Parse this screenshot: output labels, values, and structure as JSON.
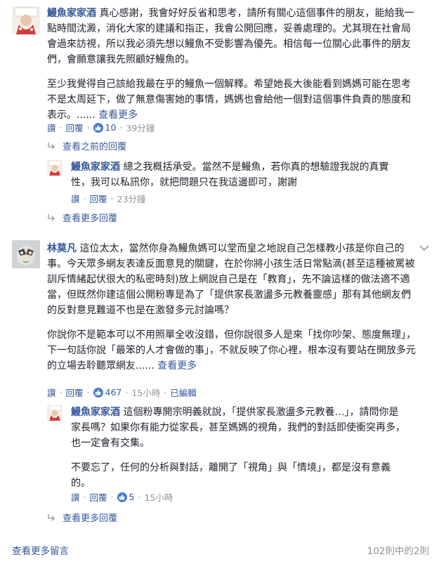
{
  "colors": {
    "link": "#365899",
    "muted": "#90949c",
    "like": "#4a7bd4"
  },
  "comments": [
    {
      "author": "鰻魚家家酒",
      "paragraphs": [
        "真心感謝，我會好好反省和思考，請所有關心這個事件的朋友，能給我一點時間沈澱，消化大家的建議和指正，我會公開回應，妥善處理的。尤其現在社會局會過來訪視，所以我必須先想以鰻魚不受影響為優先。相信每一位關心此事件的朋友們，會願意讓我先照顧好鰻魚的。",
        "至少我覺得自己該給我最在乎的鰻魚一個解釋。希望她長大後能看到媽媽可能在思考不是太周延下，做了無意傷害她的事情，媽媽也會給他一個對這個事件負責的態度和表示。......"
      ],
      "see_more": "查看更多",
      "actions": {
        "like": "讚",
        "reply": "回覆",
        "likes": "10",
        "time": "39分鐘"
      },
      "view_previous": "查看之前的回覆",
      "reply": {
        "author": "鰻魚家家酒",
        "text": "總之我概括承受。當然不是鰻魚，若你真的想驗證我說的真實性，我可以私訊你，就把問題只在我這邊即可，謝謝",
        "actions": {
          "like": "讚",
          "reply": "回覆",
          "time": "23分鐘"
        }
      },
      "view_more_replies": "查看更多回覆"
    },
    {
      "author": "林莫凡",
      "paragraphs": [
        "這位太太，當然你身為鰻魚媽可以堂而皇之地說自己怎樣教小孩是你自己的事。今天眾多網友表達反面意見的關鍵，在於你將小孩生活日常點滴(甚至這種被罵被訓斥情緒起伏很大的私密時刻)放上網說自己是在「教育」，先不論這樣的做法適不適當，但既然你建這個公開粉專是為了「提供家長激盪多元教養靈感」那有其他網友們的反對意見難道不也是在激發多元討論嗎？",
        "你說你不是範本可以不用照單全收沒錯，但你說很多人是來「找你吵架、態度無理」，下一句話你說「最笨的人才會做的事」，不就反映了你心裡，根本沒有要站在開放多元的立場去聆聽眾網友......"
      ],
      "see_more": "查看更多",
      "actions": {
        "like": "讚",
        "reply": "回覆",
        "likes": "467",
        "time": "15小時",
        "edited": "已編輯"
      },
      "reply": {
        "author": "鰻魚家家酒",
        "paragraphs": [
          "這個粉專開宗明義就說，「提供家長激盪多元教養…」，請問你是家長嗎？如果你有能力從家長，甚至媽媽的視角，我們的對話即使衝突再多，也一定會有交集。",
          "不要忘了，任何的分析與對話，離開了「視角」與「情境」，都是沒有意義的。"
        ],
        "actions": {
          "like": "讚",
          "reply": "回覆",
          "likes": "5",
          "time": "15小時"
        }
      },
      "view_more_replies": "查看更多回覆"
    }
  ],
  "footer": {
    "view_more_comments": "查看更多留言",
    "count": "102則中的2則"
  }
}
